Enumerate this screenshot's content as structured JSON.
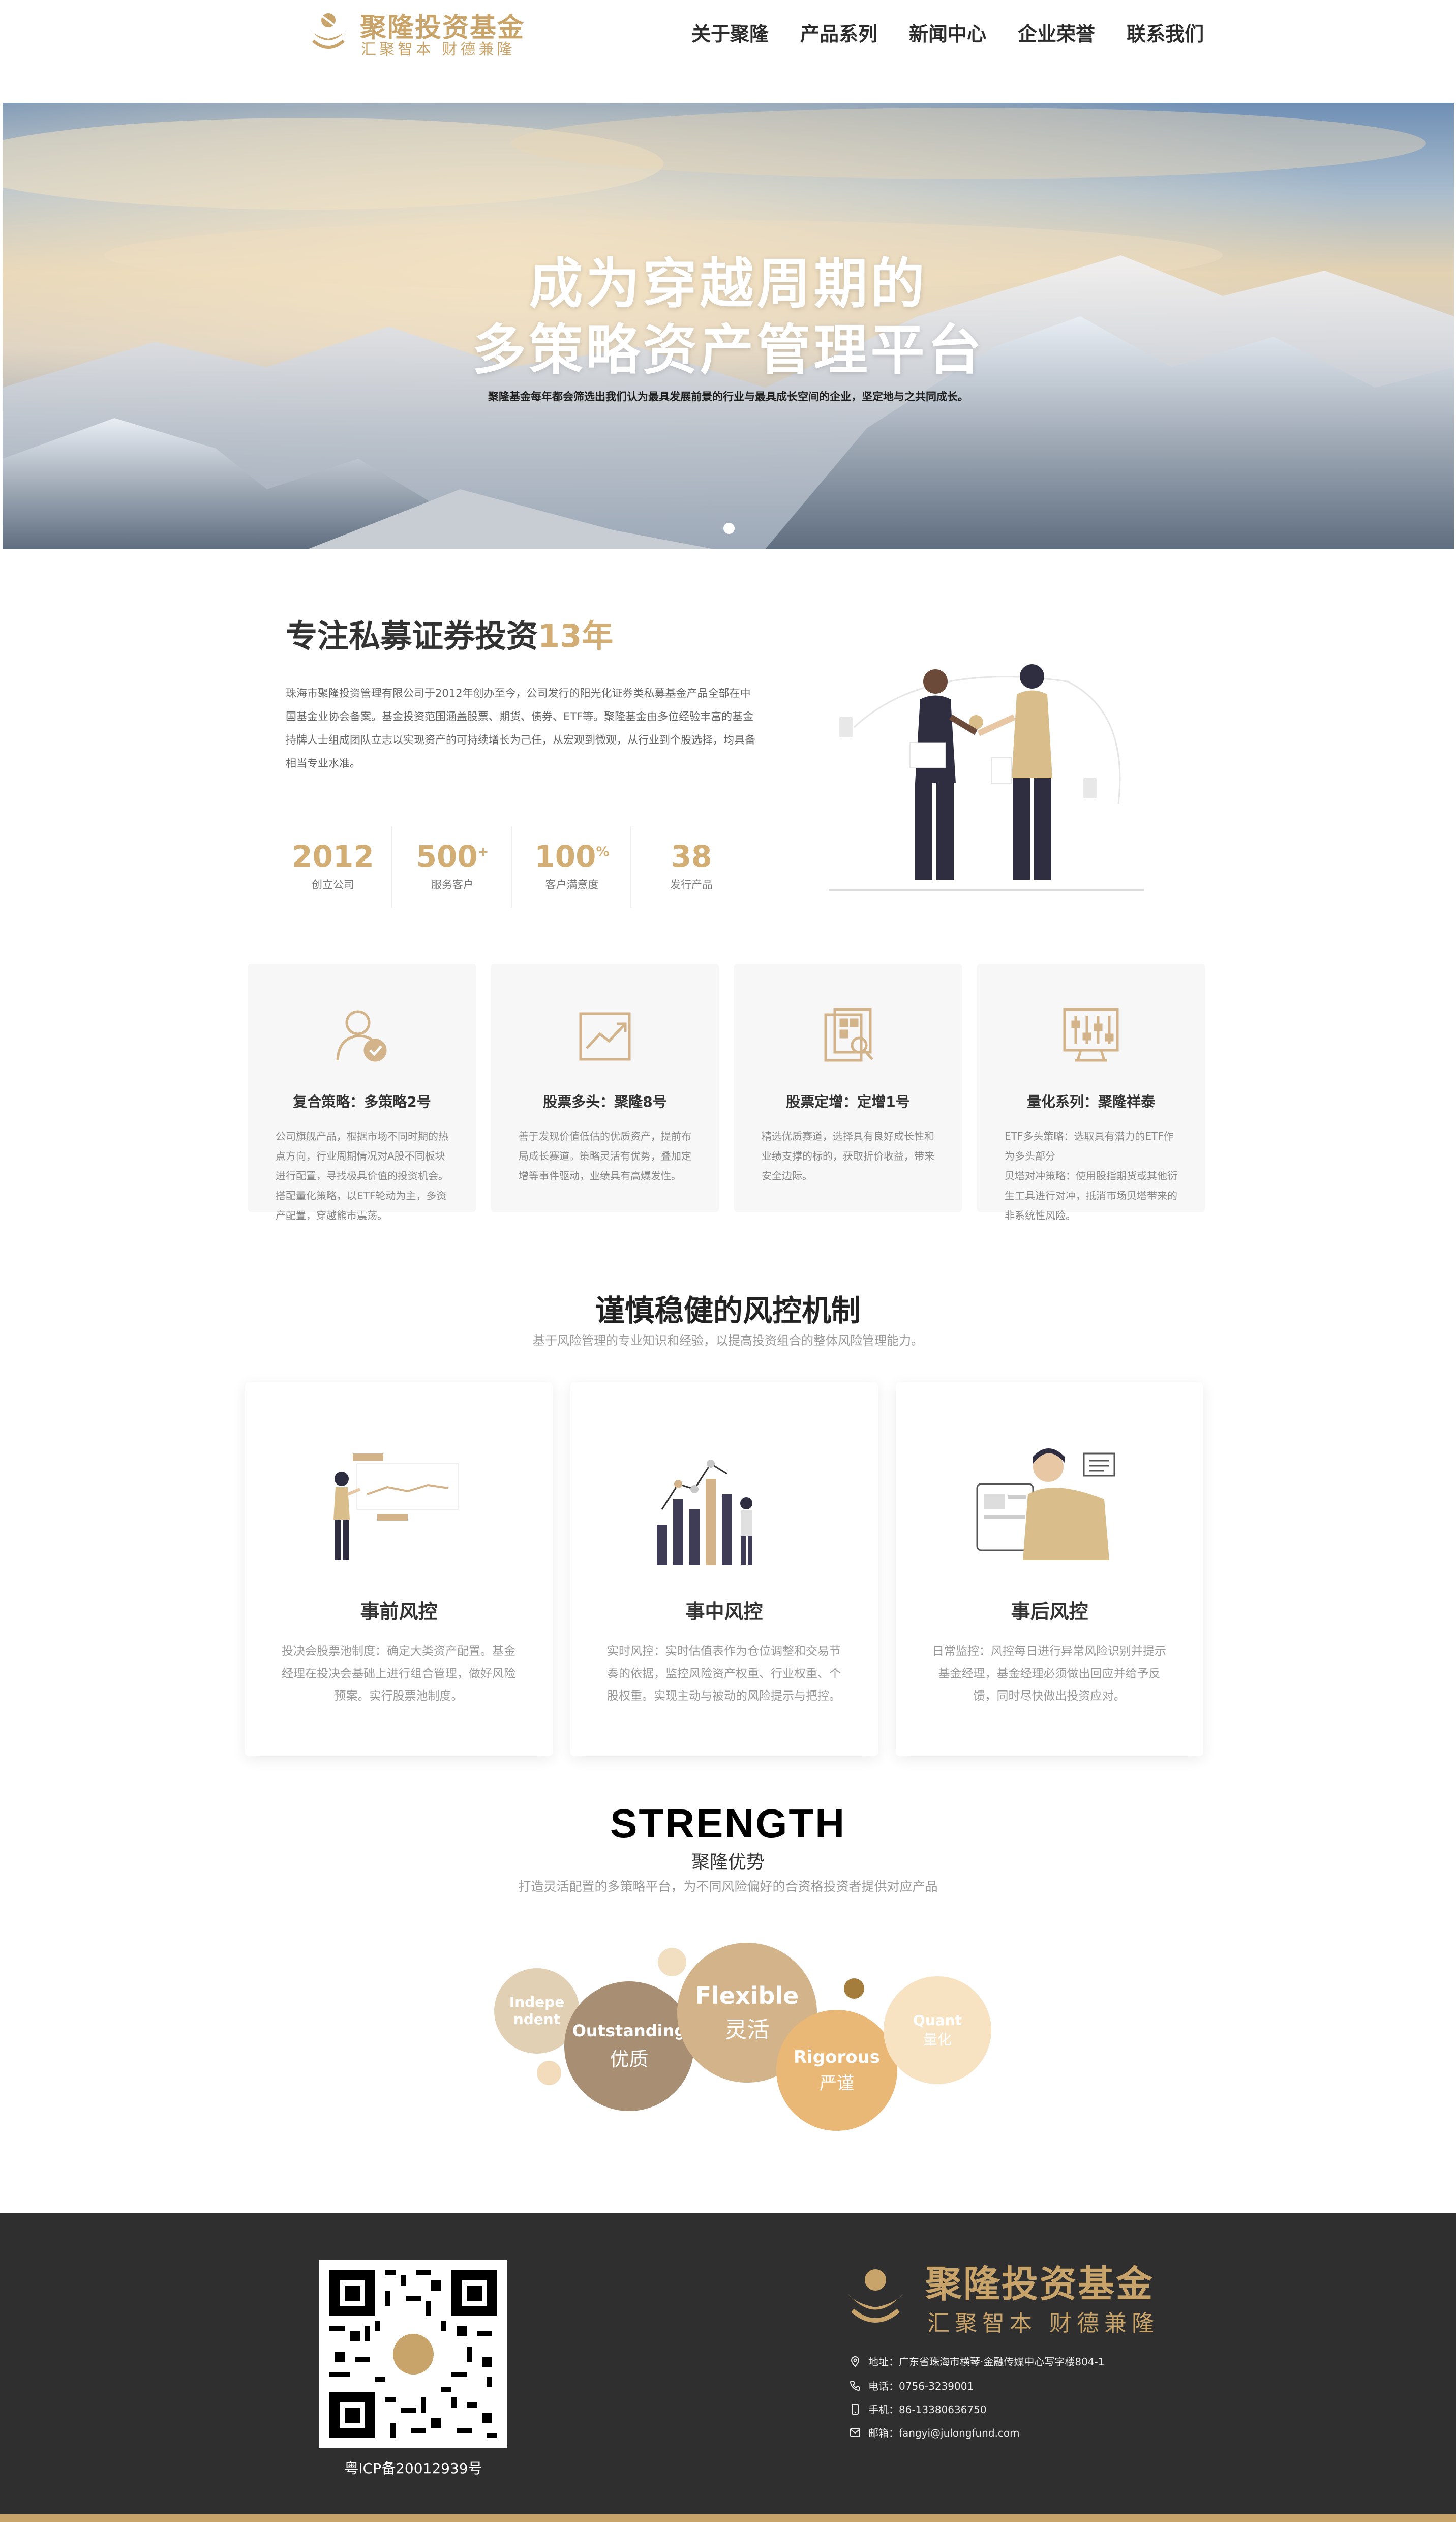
{
  "header": {
    "logo_title": "聚隆投资基金",
    "logo_sub": "汇聚智本 财德兼隆",
    "nav": [
      "关于聚隆",
      "产品系列",
      "新闻中心",
      "企业荣誉",
      "联系我们"
    ]
  },
  "hero": {
    "title_line1": "成为穿越周期的",
    "title_line2": "多策略资产管理平台",
    "subtitle": "聚隆基金每年都会筛选出我们认为最具发展前景的行业与最具成长空间的企业，坚定地与之共同成长。"
  },
  "about": {
    "title_main": "专注私募证券投资",
    "title_highlight": "13年",
    "paragraph": "珠海市聚隆投资管理有限公司于2012年创办至今，公司发行的阳光化证券类私募基金产品全部在中国基金业协会备案。基金投资范围涵盖股票、期货、债券、ETF等。聚隆基金由多位经验丰富的基金持牌人士组成团队立志以实现资产的可持续增长为己任，从宏观到微观，从行业到个股选择，均具备相当专业水准。",
    "stats": [
      {
        "value": "2012",
        "suffix": "",
        "label": "创立公司"
      },
      {
        "value": "500",
        "suffix": "+",
        "label": "服务客户"
      },
      {
        "value": "100",
        "suffix": "%",
        "label": "客户满意度"
      },
      {
        "value": "38",
        "suffix": "",
        "label": "发行产品"
      }
    ]
  },
  "products": [
    {
      "icon": "user-check-icon",
      "title": "复合策略：多策略2号",
      "desc": "公司旗舰产品，根据市场不同时期的热点方向，行业周期情况对A股不同板块进行配置，寻找极具价值的投资机会。搭配量化策略，以ETF轮动为主，多资产配置，穿越熊市震荡。"
    },
    {
      "icon": "chart-trend-icon",
      "title": "股票多头：聚隆8号",
      "desc": "善于发现价值低估的优质资产，提前布局成长赛道。策略灵活有优势，叠加定增等事件驱动，业绩具有高爆发性。"
    },
    {
      "icon": "document-search-icon",
      "title": "股票定增：定增1号",
      "desc": "精选优质赛道，选择具有良好成长性和业绩支撑的标的，获取折价收益，带来安全边际。"
    },
    {
      "icon": "equalizer-monitor-icon",
      "title": "量化系列：聚隆祥泰",
      "desc": "ETF多头策略：选取具有潜力的ETF作为多头部分\n贝塔对冲策略：使用股指期货或其他衍生工具进行对冲，抵消市场贝塔带来的非系统性风险。"
    }
  ],
  "risk": {
    "title": "谨慎稳健的风控机制",
    "subtitle": "基于风险管理的专业知识和经验，以提高投资组合的整体风险管理能力。",
    "cards": [
      {
        "title": "事前风控",
        "desc": "投决会股票池制度：确定大类资产配置。基金经理在投决会基础上进行组合管理，做好风险预案。实行股票池制度。"
      },
      {
        "title": "事中风控",
        "desc": "实时风控：实时估值表作为仓位调整和交易节奏的依据，监控风险资产权重、行业权重、个股权重。实现主动与被动的风险提示与把控。"
      },
      {
        "title": "事后风控",
        "desc": "日常监控：风控每日进行异常风险识别并提示基金经理，基金经理必须做出回应并给予反馈，同时尽快做出投资应对。"
      }
    ]
  },
  "strength": {
    "title": "STRENGTH",
    "title_cn": "聚隆优势",
    "subtitle": "打造灵活配置的多策略平台，为不同风险偏好的合资格投资者提供对应产品",
    "bubbles": [
      {
        "en": "Indepe ndent",
        "cn": ""
      },
      {
        "en": "Outstanding",
        "cn": "优质"
      },
      {
        "en": "Flexible",
        "cn": "灵活"
      },
      {
        "en": "Rigorous",
        "cn": "严谨"
      },
      {
        "en": "Quant",
        "cn": "量化"
      }
    ],
    "colors": {
      "tan_light": "#e2d0b5",
      "brown": "#a88e72",
      "tan": "#d3b38a",
      "gold": "#e9b877",
      "cream": "#f7e2c2"
    }
  },
  "footer": {
    "icp": "粤ICP备20012939号",
    "logo_title": "聚隆投资基金",
    "logo_sub": "汇聚智本 财德兼隆",
    "address": "地址：广东省珠海市横琴·金融传媒中心写字楼804-1",
    "phone": "电话：0756-3239001",
    "mobile": "手机：86-13380636750",
    "email": "邮箱：fangyi@julongfund.com"
  },
  "colors": {
    "accent_gold": "#c9a46a",
    "highlight": "#d2ae75",
    "footer_bg": "#2f2f2f"
  }
}
